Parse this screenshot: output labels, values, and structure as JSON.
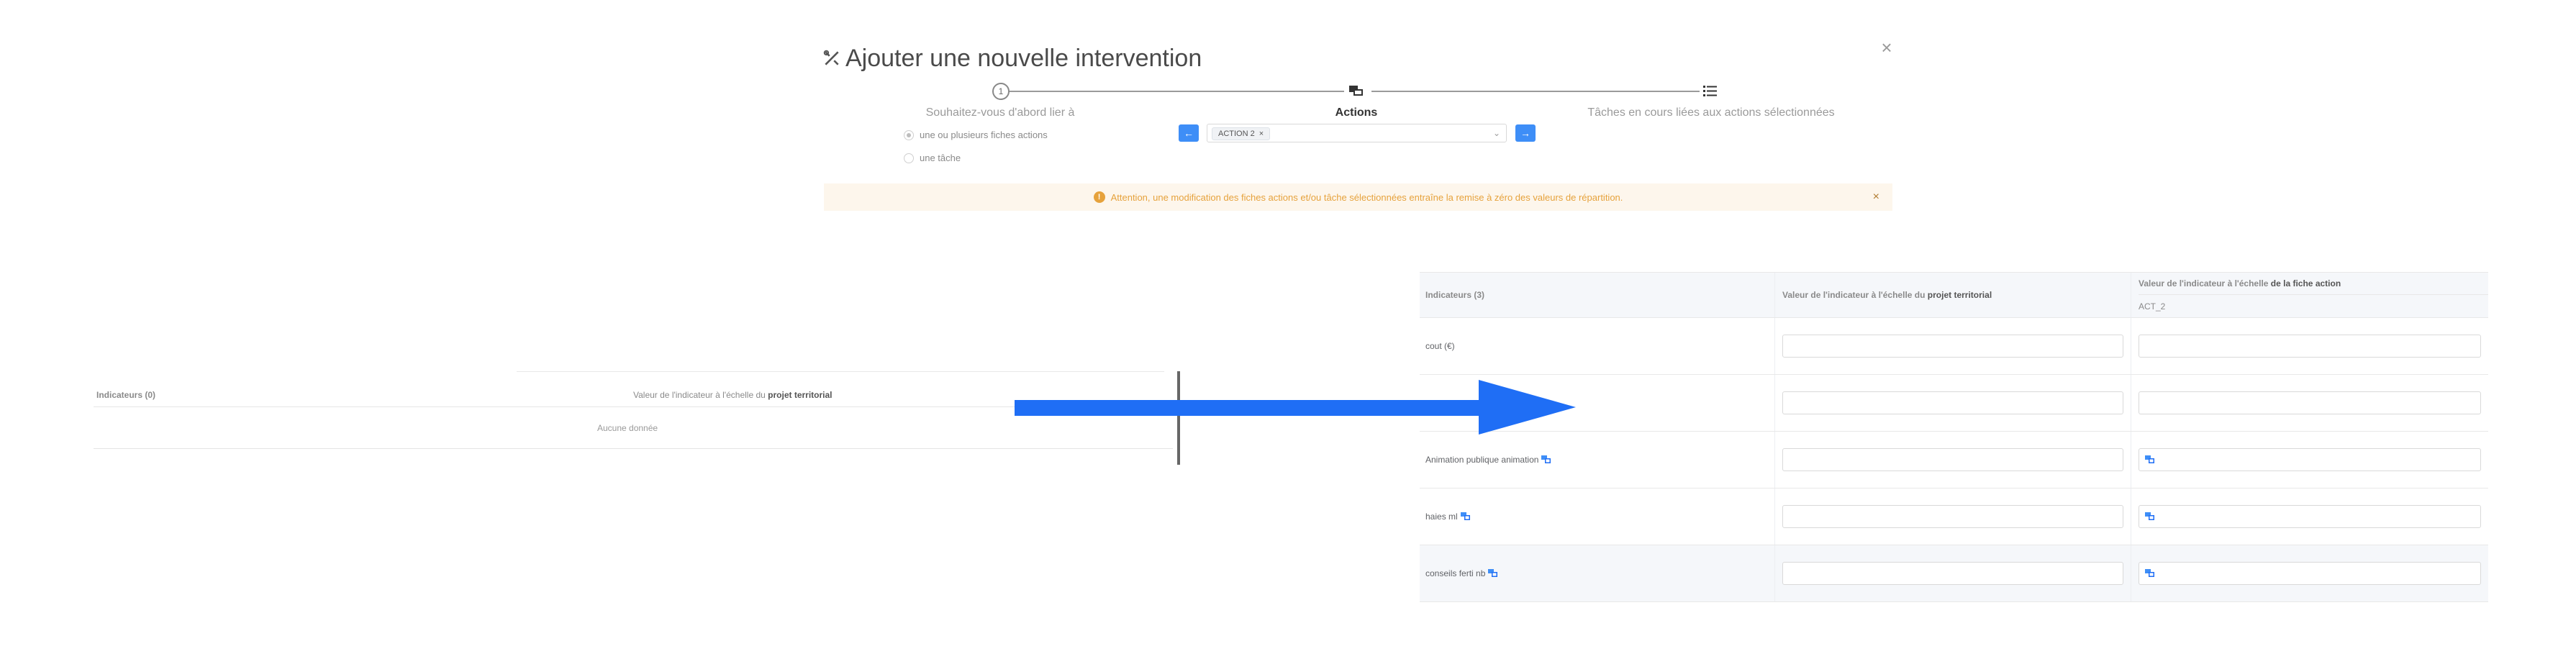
{
  "modal": {
    "title": "Ajouter une nouvelle intervention",
    "close_label": "×"
  },
  "stepper": {
    "step1_number": "1",
    "step1_label": "Souhaitez-vous d'abord lier à",
    "step2_label": "Actions",
    "step3_label": "Tâches en cours liées aux actions sélectionnées"
  },
  "link_options": [
    {
      "label": "une ou plusieurs fiches actions",
      "checked": true
    },
    {
      "label": "une tâche",
      "checked": false
    }
  ],
  "actions_select": {
    "prev_label": "←",
    "next_label": "→",
    "selected_tag": "ACTION 2",
    "tag_remove": "×",
    "caret": "⌄"
  },
  "alert": {
    "icon": "!",
    "message": "Attention, une modification des fiches actions et/ou tâche sélectionnées entraîne la remise à zéro des valeurs de répartition.",
    "close": "×"
  },
  "left_table": {
    "col1_header": "Indicateurs (0)",
    "col2_header_prefix": "Valeur de l'indicateur à l'échelle du",
    "col2_header_bold": "projet territorial",
    "empty_text": "Aucune donnée"
  },
  "right_table": {
    "col1_header": "Indicateurs (3)",
    "col2_header_prefix": "Valeur de l'indicateur à l'échelle du",
    "col2_header_bold": "projet territorial",
    "col3_header_prefix": "Valeur de l'indicateur à l'échelle",
    "col3_header_bold": "de la fiche action",
    "col3_subheader": "ACT_2",
    "rows": [
      {
        "label": "cout (€)",
        "icon": false
      },
      {
        "label": "",
        "icon": false
      },
      {
        "label": "Animation publique animation",
        "icon": true
      },
      {
        "label": "haies ml",
        "icon": true
      },
      {
        "label": "conseils ferti nb",
        "icon": true
      }
    ]
  },
  "colors": {
    "primary": "#3e8ef7",
    "arrow": "#1f6ef5",
    "warning": "#e6a23c",
    "warning_bg": "#fdf6ec"
  }
}
